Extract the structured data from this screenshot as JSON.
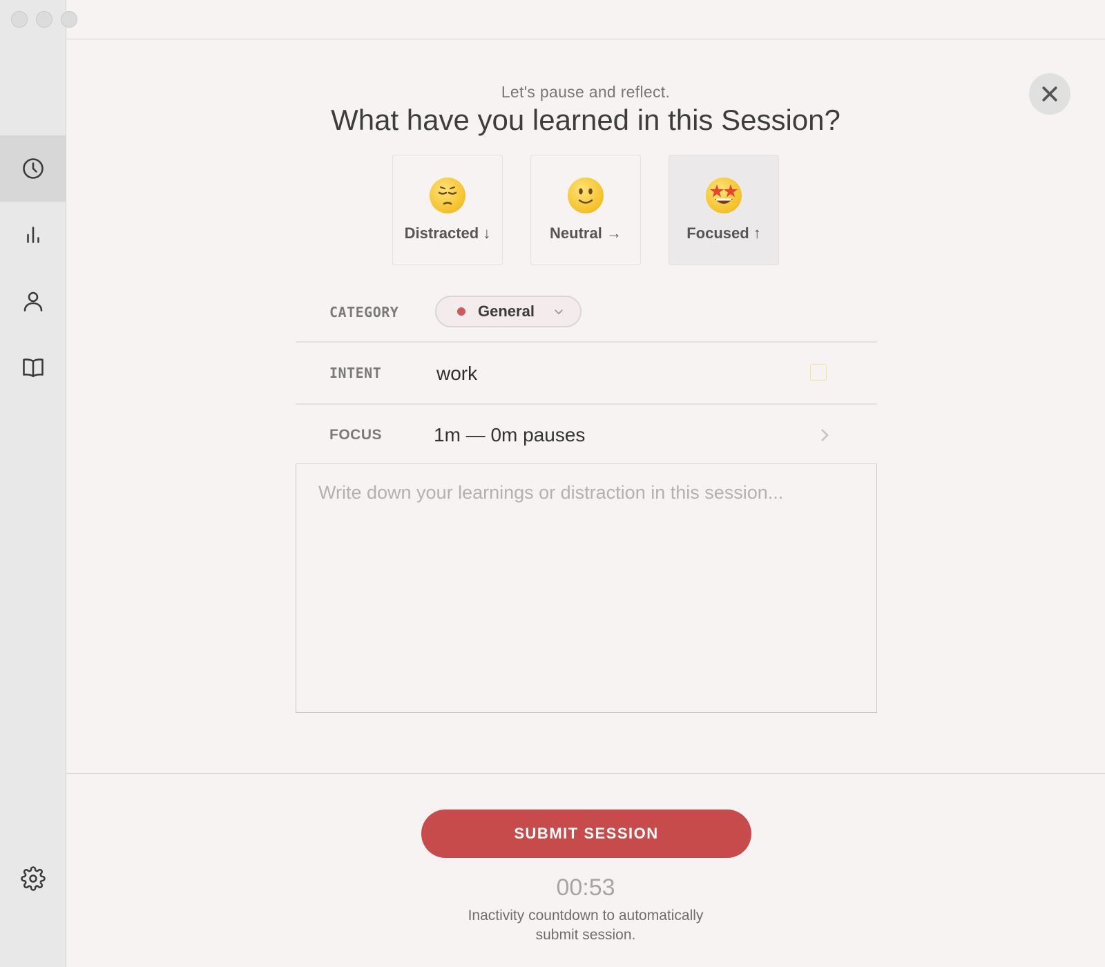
{
  "window": {
    "traffic_lights": [
      "close",
      "minimize",
      "zoom"
    ]
  },
  "sidebar": {
    "items": [
      {
        "icon": "clock-icon",
        "active": true
      },
      {
        "icon": "bar-chart-icon",
        "active": false
      },
      {
        "icon": "user-icon",
        "active": false
      },
      {
        "icon": "book-icon",
        "active": false
      }
    ],
    "footer_icon": "gear-icon"
  },
  "header": {
    "subtitle": "Let's pause and reflect.",
    "title": "What have you learned in this Session?"
  },
  "moods": [
    {
      "label": "Distracted ↓",
      "emoji": "pensive-face",
      "selected": false
    },
    {
      "label": "Neutral →",
      "emoji": "slightly-smiling-face",
      "selected": false
    },
    {
      "label": "Focused ↑",
      "emoji": "star-struck-face",
      "selected": true
    }
  ],
  "form": {
    "category_label": "CATEGORY",
    "category_value": "General",
    "category_color": "#d05a5a",
    "intent_label": "INTENT",
    "intent_value": "work",
    "focus_label": "FOCUS",
    "focus_value": "1m — 0m pauses",
    "notes_placeholder": "Write down your learnings or distraction in this session..."
  },
  "footer": {
    "submit_label": "SUBMIT SESSION",
    "timer": "00:53",
    "timer_caption": "Inactivity countdown to automatically submit session."
  },
  "colors": {
    "accent": "#c84b4b",
    "background": "#f7f3f3",
    "sidebar": "#e8e8e8"
  }
}
